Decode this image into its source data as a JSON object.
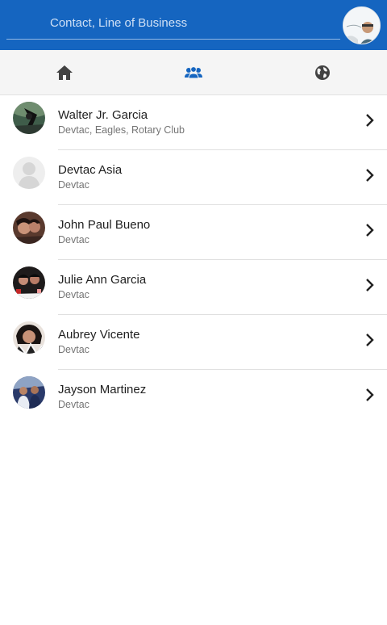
{
  "search": {
    "placeholder": "Contact, Line of Business",
    "value": ""
  },
  "tabs": [
    {
      "name": "home",
      "icon": "home-icon"
    },
    {
      "name": "groups",
      "icon": "groups-icon"
    },
    {
      "name": "world",
      "icon": "globe-icon"
    }
  ],
  "contacts": [
    {
      "name": "Walter Jr. Garcia",
      "orgs": "Devtac, Eagles, Rotary Club"
    },
    {
      "name": "Devtac Asia",
      "orgs": "Devtac"
    },
    {
      "name": "John Paul Bueno",
      "orgs": "Devtac"
    },
    {
      "name": "Julie Ann Garcia",
      "orgs": "Devtac"
    },
    {
      "name": "Aubrey Vicente",
      "orgs": "Devtac"
    },
    {
      "name": "Jayson Martinez",
      "orgs": "Devtac"
    }
  ],
  "colors": {
    "primary": "#1565c0",
    "tab_icon": "#424242",
    "group_icon": "#1565c0",
    "chevron": "#212121"
  }
}
